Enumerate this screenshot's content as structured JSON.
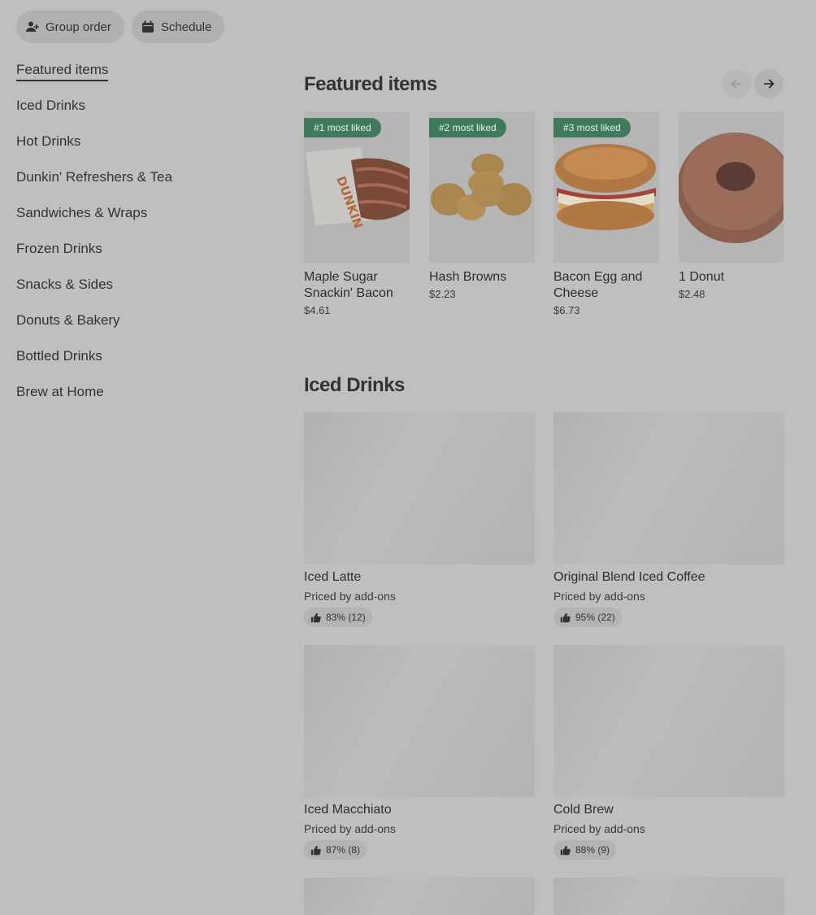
{
  "top_actions": {
    "group_order": "Group order",
    "schedule": "Schedule"
  },
  "sidebar": {
    "items": [
      {
        "label": "Featured items"
      },
      {
        "label": "Iced Drinks"
      },
      {
        "label": "Hot Drinks"
      },
      {
        "label": "Dunkin' Refreshers & Tea"
      },
      {
        "label": "Sandwiches & Wraps"
      },
      {
        "label": "Frozen Drinks"
      },
      {
        "label": "Snacks & Sides"
      },
      {
        "label": "Donuts & Bakery"
      },
      {
        "label": "Bottled Drinks"
      },
      {
        "label": "Brew at Home"
      }
    ]
  },
  "featured": {
    "title": "Featured items",
    "items": [
      {
        "badge": "#1 most liked",
        "name": "Maple Sugar Snackin' Bacon",
        "price": "$4.61"
      },
      {
        "badge": "#2 most liked",
        "name": "Hash Browns",
        "price": "$2.23"
      },
      {
        "badge": "#3 most liked",
        "name": "Bacon Egg and Cheese",
        "price": "$6.73"
      },
      {
        "badge": "",
        "name": "1 Donut",
        "price": "$2.48"
      }
    ]
  },
  "iced": {
    "title": "Iced Drinks",
    "items": [
      {
        "name": "Iced Latte",
        "sub": "Priced by add-ons",
        "rating": "83% (12)"
      },
      {
        "name": "Original Blend Iced Coffee",
        "sub": "Priced by add-ons",
        "rating": "95% (22)"
      },
      {
        "name": "Iced Macchiato",
        "sub": "Priced by add-ons",
        "rating": "87% (8)"
      },
      {
        "name": "Cold Brew",
        "sub": "Priced by add-ons",
        "rating": "88% (9)"
      }
    ]
  },
  "colors": {
    "badge_green": "#3f7a5c",
    "overlay_gray": "#bfbfbf"
  }
}
